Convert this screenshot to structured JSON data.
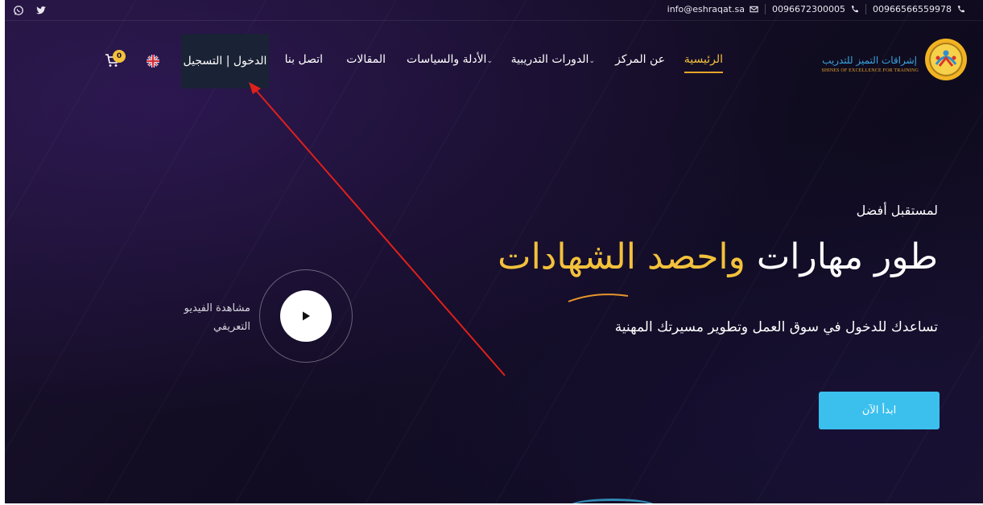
{
  "topbar": {
    "social": [
      {
        "icon": "whatsapp-icon"
      },
      {
        "icon": "twitter-icon"
      }
    ],
    "email": "info@eshraqat.sa",
    "phone1": "0096672300005",
    "phone2": "00966566559978"
  },
  "logo": {
    "name_ar": "إشراقات التميز للتدريب",
    "name_en": "SHINES OF EXCELLENCE FOR TRAINING"
  },
  "nav": {
    "home": "الرئيسية",
    "about": "عن المركز",
    "courses": "الدورات التدريبية",
    "guides": "الأدلة والسياسات",
    "articles": "المقالات",
    "contact": "اتصل بنا",
    "login": "الدخول | التسجيل",
    "cart_count": "0"
  },
  "hero": {
    "subtitle": "لمستقبل أفضل",
    "title_main": "طور مهارات ",
    "title_highlight": "واحصد الشهادات",
    "description": "تساعدك للدخول في سوق العمل وتطوير مسيرتك المهنية",
    "start_button": "ابدأ الآن"
  },
  "video": {
    "line1": "مشاهدة الفيديو",
    "line2": "التعريفي"
  },
  "colors": {
    "accent_gold": "#f3c13b",
    "accent_cyan": "#3bc0ee",
    "background": "#130d24",
    "annotation_red": "#e0201b"
  }
}
